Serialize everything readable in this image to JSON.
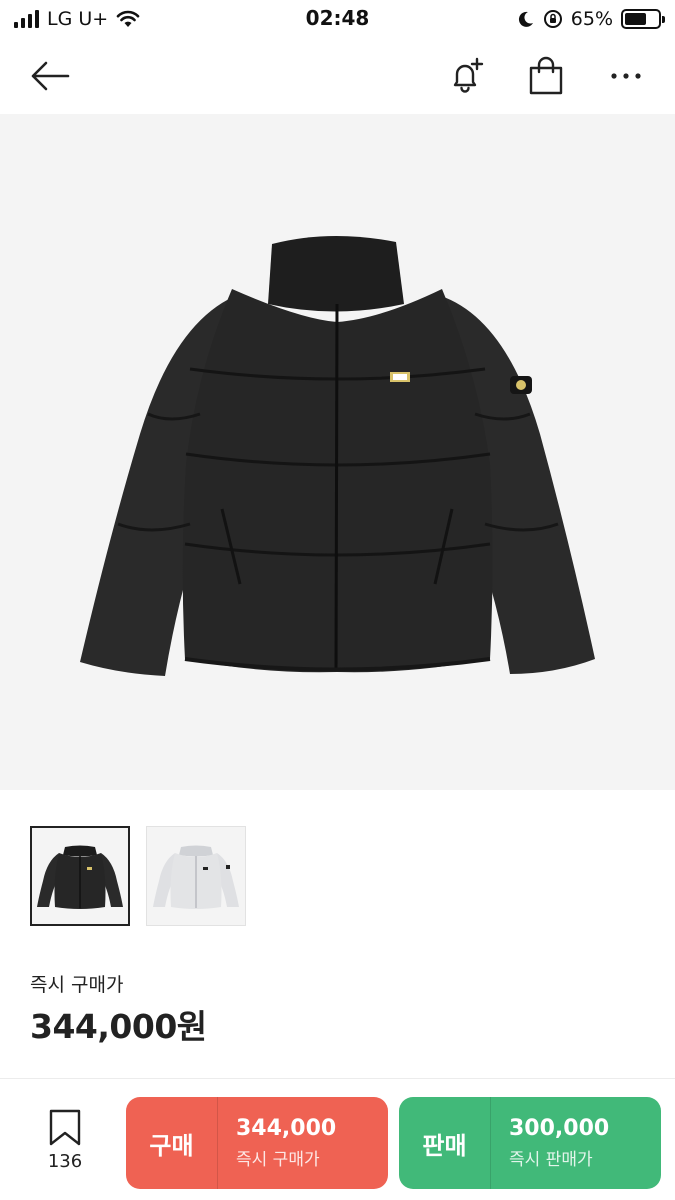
{
  "status_bar": {
    "carrier": "LG U+",
    "time": "02:48",
    "battery_text": "65%",
    "battery_level": 0.65
  },
  "nav": {
    "icons": [
      "back-arrow-icon",
      "bell-plus-icon",
      "shopping-bag-icon",
      "more-icon"
    ]
  },
  "product": {
    "colors": {
      "main": "#262626",
      "alt": "#e3e4e6",
      "background": "#f4f4f4"
    }
  },
  "thumbnails": [
    {
      "variant": "black",
      "selected": true
    },
    {
      "variant": "white",
      "selected": false
    }
  ],
  "price": {
    "label": "즉시 구매가",
    "value": "344,000원"
  },
  "bottom": {
    "wish_count": "136",
    "buy": {
      "main_label": "구매",
      "price": "344,000",
      "sub_label": "즉시 구매가",
      "color": "#ef6253"
    },
    "sell": {
      "main_label": "판매",
      "price": "300,000",
      "sub_label": "즉시 판매가",
      "color": "#41b979"
    }
  }
}
